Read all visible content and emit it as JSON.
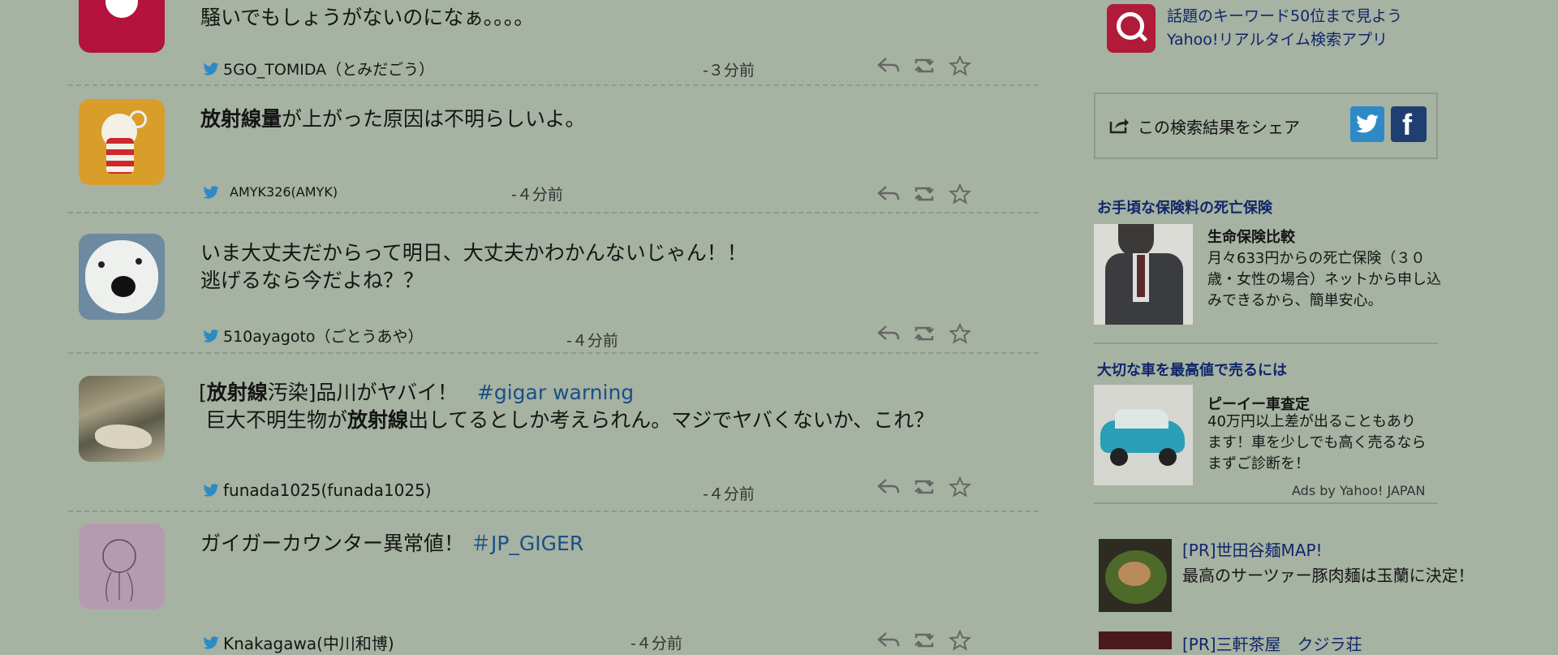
{
  "tweets": [
    {
      "text_lines": [
        "騒いでもしょうがないのになぁ。。。。"
      ],
      "username": "5GO_TOMIDA（とみだごう）",
      "time": "-３分前"
    },
    {
      "text_bold": "放射線量",
      "text_rest": "が上がった原因は不明らしいよ。",
      "username": "AMYK326(AMYK)",
      "time": "-４分前"
    },
    {
      "text_lines": [
        "いま大丈夫だからって明日、大丈夫かわかんないじゃん！！",
        "逃げるなら今だよね？？"
      ],
      "username": "510ayagoto（ごとうあや）",
      "time": "-４分前"
    },
    {
      "line1_prefix": "[",
      "line1_bold": "放射線",
      "line1_rest": "汚染]品川がヤバイ！",
      "hashtag": "#gigar warning",
      "line2_prefix": " 巨大不明生物が",
      "line2_bold": "放射線",
      "line2_rest": "出してるとしか考えられん。マジでヤバくないか、これ？",
      "username": "funada1025(funada1025)",
      "time": "-４分前"
    },
    {
      "text": "ガイガーカウンター異常値！",
      "hashtag": "＃JP_GIGER",
      "username": "Knakagawa(中川和博)",
      "time": "-４分前"
    }
  ],
  "sidebar": {
    "app_promo": {
      "line1": "話題のキーワード50位まで見よう",
      "line2": "Yahoo!リアルタイム検索アプリ"
    },
    "share": {
      "label": "この検索結果をシェア"
    },
    "ads": [
      {
        "title": "お手頃な保険料の死亡保険",
        "headline": "生命保険比較",
        "body": "月々633円からの死亡保険（３０歳・女性の場合）ネットから申し込みできるから、簡単安心。"
      },
      {
        "title": "大切な車を最高値で売るには",
        "headline": "ピーイー車査定",
        "body": "40万円以上差が出ることもあります！車を少しでも高く売るならまずご診断を！"
      }
    ],
    "ads_credit": "Ads by Yahoo! JAPAN",
    "pr": [
      {
        "title": "[PR]世田谷麺MAP!",
        "body": "最高のサーツァー豚肉麺は玉蘭に決定！"
      },
      {
        "title": "[PR]三軒茶屋　クジラ荘",
        "body": ""
      }
    ],
    "colors": {
      "twitter": "#2d8ac7",
      "facebook": "#1f3f73",
      "app_red": "#b01b3a",
      "link": "#10266a",
      "hashtag": "#1a4f86"
    }
  }
}
